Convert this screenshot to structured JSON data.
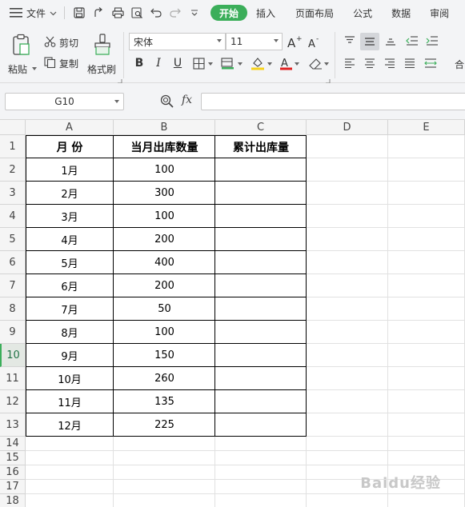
{
  "menubar": {
    "file_label": "文件",
    "tabs": [
      "开始",
      "插入",
      "页面布局",
      "公式",
      "数据",
      "审阅"
    ],
    "active_tab": "开始"
  },
  "ribbon": {
    "paste": "粘贴",
    "cut": "剪切",
    "copy": "复制",
    "format_painter": "格式刷",
    "font_name": "宋体",
    "font_size": "11",
    "merge_partial": "合"
  },
  "formula_bar": {
    "name_box": "G10",
    "fx": "fx",
    "content": ""
  },
  "sheet": {
    "columns": [
      "A",
      "B",
      "C",
      "D",
      "E"
    ],
    "rows": [
      "1",
      "2",
      "3",
      "4",
      "5",
      "6",
      "7",
      "8",
      "9",
      "10",
      "11",
      "12",
      "13",
      "14",
      "15",
      "16",
      "17",
      "18"
    ],
    "selected_row": "10",
    "header": [
      "月  份",
      "当月出库数量",
      "累计出库量"
    ],
    "data": [
      [
        "1月",
        "100",
        ""
      ],
      [
        "2月",
        "300",
        ""
      ],
      [
        "3月",
        "100",
        ""
      ],
      [
        "4月",
        "200",
        ""
      ],
      [
        "5月",
        "400",
        ""
      ],
      [
        "6月",
        "200",
        ""
      ],
      [
        "7月",
        "50",
        ""
      ],
      [
        "8月",
        "100",
        ""
      ],
      [
        "9月",
        "150",
        ""
      ],
      [
        "10月",
        "260",
        ""
      ],
      [
        "11月",
        "135",
        ""
      ],
      [
        "12月",
        "225",
        ""
      ]
    ]
  },
  "watermark": "Baidu经验",
  "colors": {
    "accent": "#3bae5a"
  }
}
